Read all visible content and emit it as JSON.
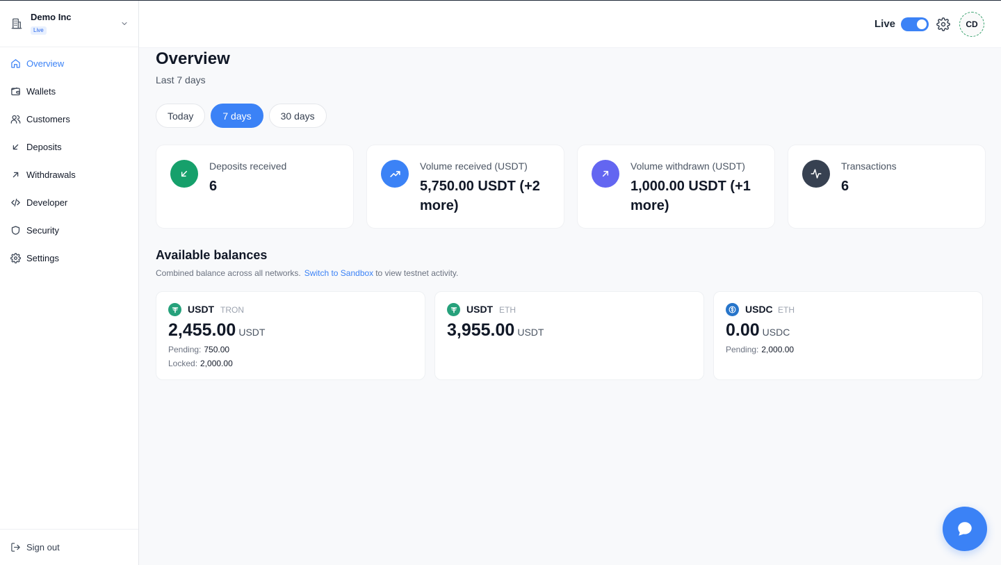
{
  "org": {
    "name": "Demo Inc",
    "badge": "Live"
  },
  "nav": {
    "items": [
      {
        "label": "Overview",
        "icon": "home-icon",
        "active": true
      },
      {
        "label": "Wallets",
        "icon": "wallet-icon"
      },
      {
        "label": "Customers",
        "icon": "users-icon"
      },
      {
        "label": "Deposits",
        "icon": "arrow-down-left-icon"
      },
      {
        "label": "Withdrawals",
        "icon": "arrow-up-right-icon"
      },
      {
        "label": "Developer",
        "icon": "code-icon"
      },
      {
        "label": "Security",
        "icon": "shield-icon"
      },
      {
        "label": "Settings",
        "icon": "gear-icon"
      }
    ],
    "signout": "Sign out"
  },
  "topbar": {
    "live_label": "Live",
    "live_on": true,
    "avatar_initials": "CD"
  },
  "main": {
    "title": "Overview",
    "subtitle": "Last 7 days",
    "ranges": [
      {
        "label": "Today",
        "active": false
      },
      {
        "label": "7 days",
        "active": true
      },
      {
        "label": "30 days",
        "active": false
      }
    ],
    "stats": [
      {
        "title": "Deposits received",
        "value": "6",
        "icon": "arrow-down-left-icon",
        "color": "#16a06b"
      },
      {
        "title": "Volume received (USDT)",
        "value": "5,750.00 USDT (+2 more)",
        "icon": "trending-up-icon",
        "color": "#3b82f6"
      },
      {
        "title": "Volume withdrawn (USDT)",
        "value": "1,000.00 USDT (+1 more)",
        "icon": "arrow-up-right-icon",
        "color": "#6366f1"
      },
      {
        "title": "Transactions",
        "value": "6",
        "icon": "activity-icon",
        "color": "#374151"
      }
    ],
    "balances_title": "Available balances",
    "balances_sub_before": "Combined balance across all networks.",
    "balances_sub_link": "Switch to Sandbox",
    "balances_sub_after": "to view testnet activity.",
    "balances": [
      {
        "symbol": "USDT",
        "network": "TRON",
        "amount": "2,455.00",
        "unit": "USDT",
        "pending_label": "Pending:",
        "pending": "750.00",
        "locked_label": "Locked:",
        "locked": "2,000.00",
        "coin_color": "#26a17b"
      },
      {
        "symbol": "USDT",
        "network": "ETH",
        "amount": "3,955.00",
        "unit": "USDT",
        "coin_color": "#26a17b"
      },
      {
        "symbol": "USDC",
        "network": "ETH",
        "amount": "0.00",
        "unit": "USDC",
        "pending_label": "Pending:",
        "pending": "2,000.00",
        "coin_color": "#2775ca"
      }
    ]
  }
}
